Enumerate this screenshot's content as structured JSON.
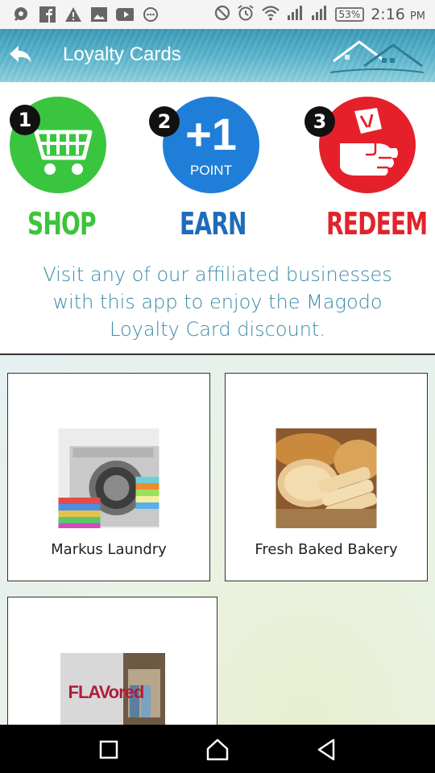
{
  "status_bar": {
    "battery": "53%",
    "time": "2:16",
    "ampm": "PM"
  },
  "header": {
    "title": "Loyalty Cards"
  },
  "steps": [
    {
      "number": "1",
      "label": "SHOP",
      "color": "#3cb54a",
      "circle": "#2ecc40",
      "icon": "shopping-cart-icon"
    },
    {
      "number": "2",
      "label": "EARN",
      "color": "#1d6fbf",
      "circle": "#1f7fd8",
      "big": "+1",
      "small": "POINT",
      "icon": "plus-one-point-icon"
    },
    {
      "number": "3",
      "label": "REDEEM",
      "color": "#e0242c",
      "circle": "#e5202a",
      "icon": "hand-money-icon"
    }
  ],
  "description": [
    "Visit any of our affiliated businesses",
    "with this app to enjoy the Magodo",
    "Loyalty Card discount."
  ],
  "businesses": [
    {
      "name": "Markus Laundry"
    },
    {
      "name": "Fresh Baked Bakery"
    },
    {
      "name": "",
      "sign": "FLAVored"
    }
  ]
}
